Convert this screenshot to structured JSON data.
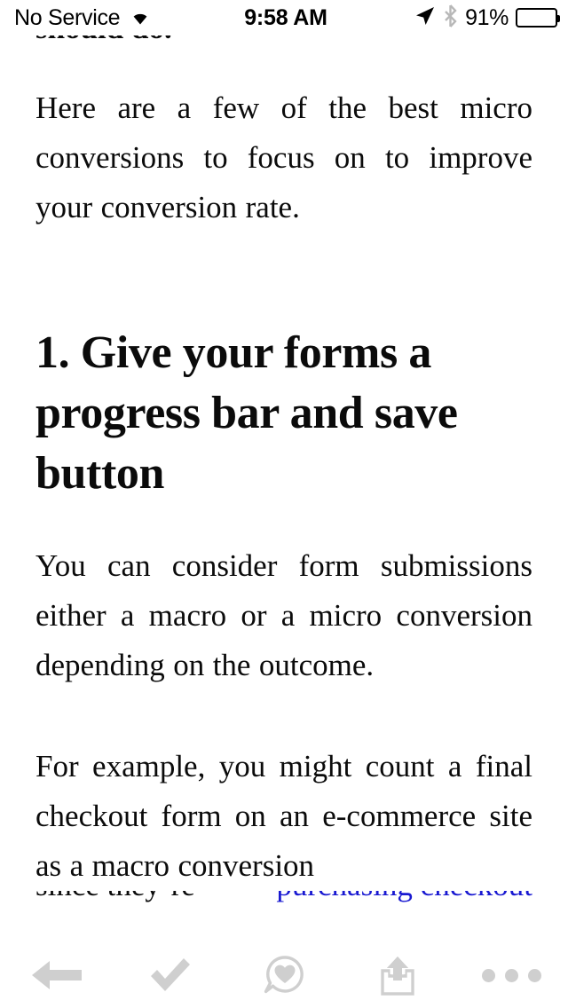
{
  "status_bar": {
    "carrier": "No Service",
    "wifi_icon": "wifi-icon",
    "time": "9:58 AM",
    "location_icon": "location-arrow-icon",
    "bluetooth_icon": "bluetooth-icon",
    "battery_percent": "91%",
    "battery_icon": "battery-icon",
    "battery_level": 91
  },
  "article": {
    "clipped_top_line": "should do.",
    "paragraph_1": "Here are a few of the best micro conversions to focus on to improve your conversion rate.",
    "heading_1": "1. Give your forms a progress bar and save button",
    "paragraph_2": "You can consider form submissions either a macro or a micro conversion depending on the outcome.",
    "paragraph_3": "For example, you might count a final checkout form on an e-commerce site as a macro conversion",
    "clipped_bottom_prefix": "since they’re",
    "clipped_bottom_link": "purchasing checkout"
  },
  "colors": {
    "text": "#0b0b0b",
    "link": "#1919d1",
    "toolbar_icon": "#cfcfcf",
    "background": "#ffffff"
  },
  "toolbar": {
    "items": [
      {
        "name": "back-button",
        "icon": "back-arrow-icon",
        "label": "Back"
      },
      {
        "name": "mark-read-button",
        "icon": "checkmark-icon",
        "label": "Mark as read"
      },
      {
        "name": "like-button",
        "icon": "heart-bubble-icon",
        "label": "Like"
      },
      {
        "name": "share-button",
        "icon": "share-icon",
        "label": "Share"
      },
      {
        "name": "more-button",
        "icon": "more-dots-icon",
        "label": "More"
      }
    ]
  }
}
